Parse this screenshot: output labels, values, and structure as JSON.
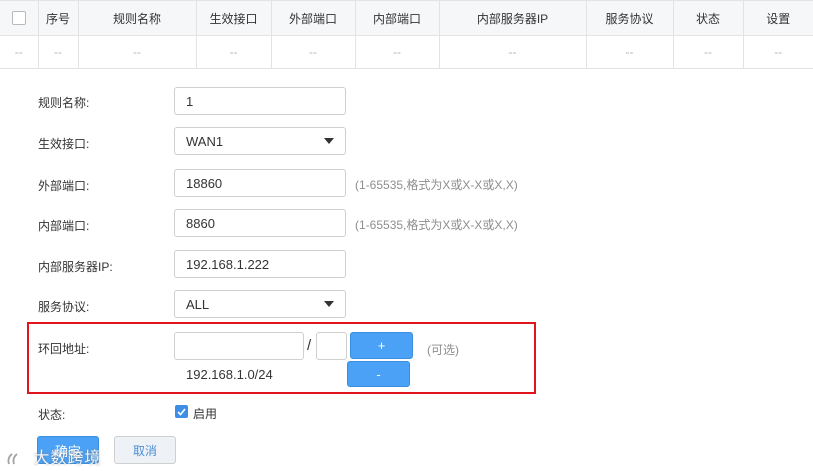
{
  "table": {
    "headers": [
      "序号",
      "规则名称",
      "生效接口",
      "外部端口",
      "内部端口",
      "内部服务器IP",
      "服务协议",
      "状态",
      "设置"
    ],
    "empty_row": [
      "--",
      "--",
      "--",
      "--",
      "--",
      "--",
      "--",
      "--",
      "--",
      "--"
    ]
  },
  "form": {
    "rule_name": {
      "label": "规则名称:",
      "value": "1"
    },
    "interface": {
      "label": "生效接口:",
      "value": "WAN1"
    },
    "external_port": {
      "label": "外部端口:",
      "value": "18860",
      "hint": "(1-65535,格式为X或X-X或X,X)"
    },
    "internal_port": {
      "label": "内部端口:",
      "value": "8860",
      "hint": "(1-65535,格式为X或X-X或X,X)"
    },
    "server_ip": {
      "label": "内部服务器IP:",
      "value": "192.168.1.222"
    },
    "protocol": {
      "label": "服务协议:",
      "value": "ALL"
    },
    "loopback": {
      "label": "环回地址:",
      "ip_value": "",
      "slash": "/",
      "mask_value": "",
      "add_label": "+",
      "remove_label": "-",
      "optional_hint": "(可选)",
      "entries": [
        "192.168.1.0/24"
      ]
    },
    "status": {
      "label": "状态:",
      "checkbox_label": "启用",
      "checked": true
    }
  },
  "actions": {
    "confirm_label": "确定",
    "cancel_label": "取消"
  },
  "watermark": "大数跨境",
  "colors": {
    "primary": "#4aa1f5",
    "highlight": "#e1141b"
  }
}
